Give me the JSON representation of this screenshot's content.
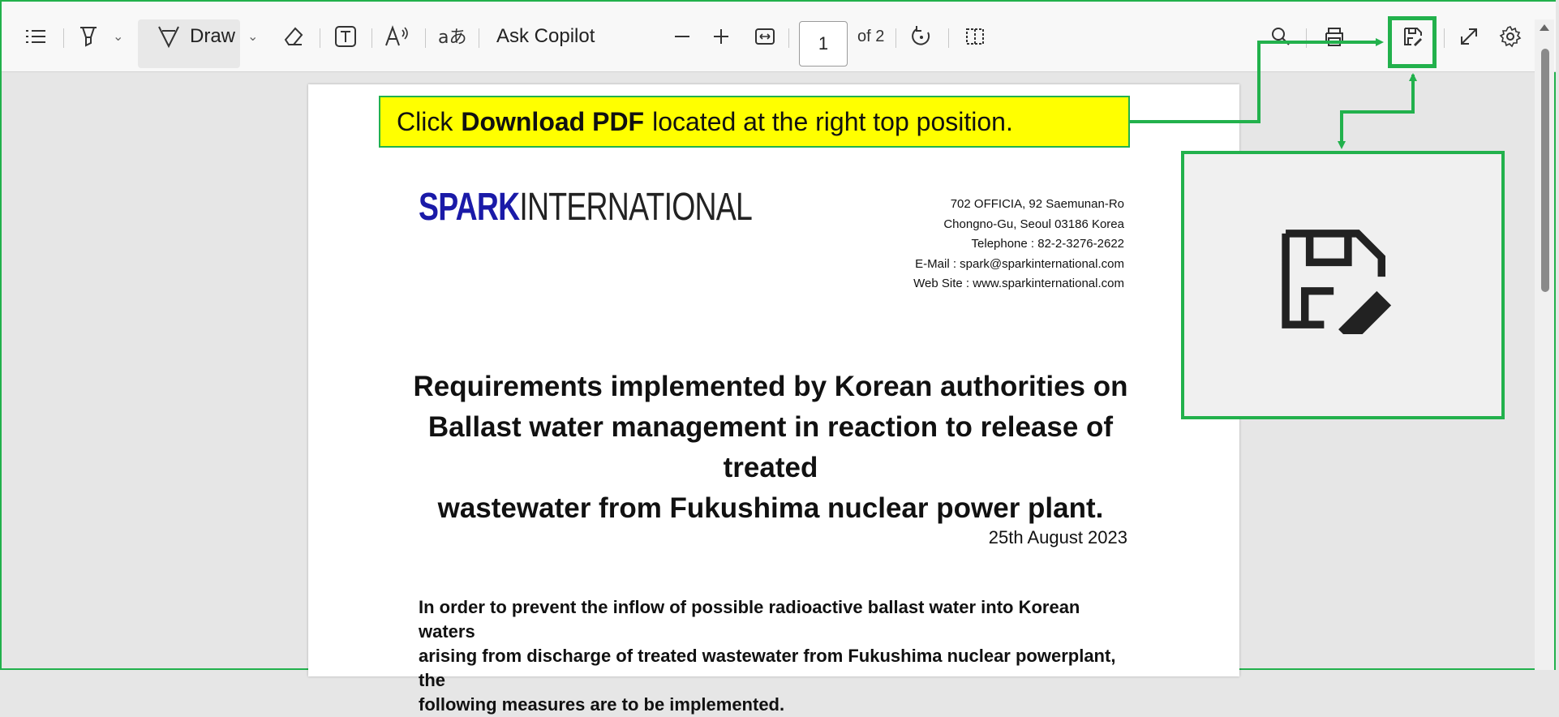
{
  "toolbar": {
    "draw_label": "Draw",
    "ask_copilot_label": "Ask Copilot",
    "page_number": "1",
    "page_total": "of 2"
  },
  "callout": {
    "prefix": "Click",
    "bold": "Download PDF",
    "suffix": "located at the right top position."
  },
  "document": {
    "logo_bold": "SPARK",
    "logo_rest": "INTERNATIONAL",
    "address_lines": [
      "702 OFFICIA, 92 Saemunan-Ro",
      "Chongno-Gu, Seoul 03186 Korea",
      "Telephone : 82-2-3276-2622",
      "E-Mail : spark@sparkinternational.com",
      "Web Site : www.sparkinternational.com"
    ],
    "title_lines": [
      "Requirements implemented by Korean authorities on",
      "Ballast water management in reaction to release of treated",
      "wastewater from Fukushima nuclear power plant."
    ],
    "date": "25th August 2023",
    "body_lines": [
      "In order to prevent the inflow of possible radioactive ballast water into Korean waters",
      "arising from discharge of treated wastewater from Fukushima nuclear powerplant, the",
      "following measures are to be implemented."
    ]
  },
  "icons": {
    "toc": "list-icon",
    "highlight": "highlighter-icon",
    "draw": "draw-icon",
    "erase": "eraser-icon",
    "text": "text-box-icon",
    "read_aloud": "read-aloud-icon",
    "translate": "translate-icon",
    "zoom_out": "minus-icon",
    "zoom_in": "plus-icon",
    "fit": "fit-width-icon",
    "rotate": "rotate-icon",
    "page_view": "page-view-icon",
    "search": "search-icon",
    "print": "print-icon",
    "save": "save-as-icon",
    "fullscreen": "expand-icon",
    "settings": "gear-icon"
  },
  "colors": {
    "annotation": "#22b14c",
    "callout_bg": "#ffff00",
    "logo_blue": "#1a1aa8"
  }
}
